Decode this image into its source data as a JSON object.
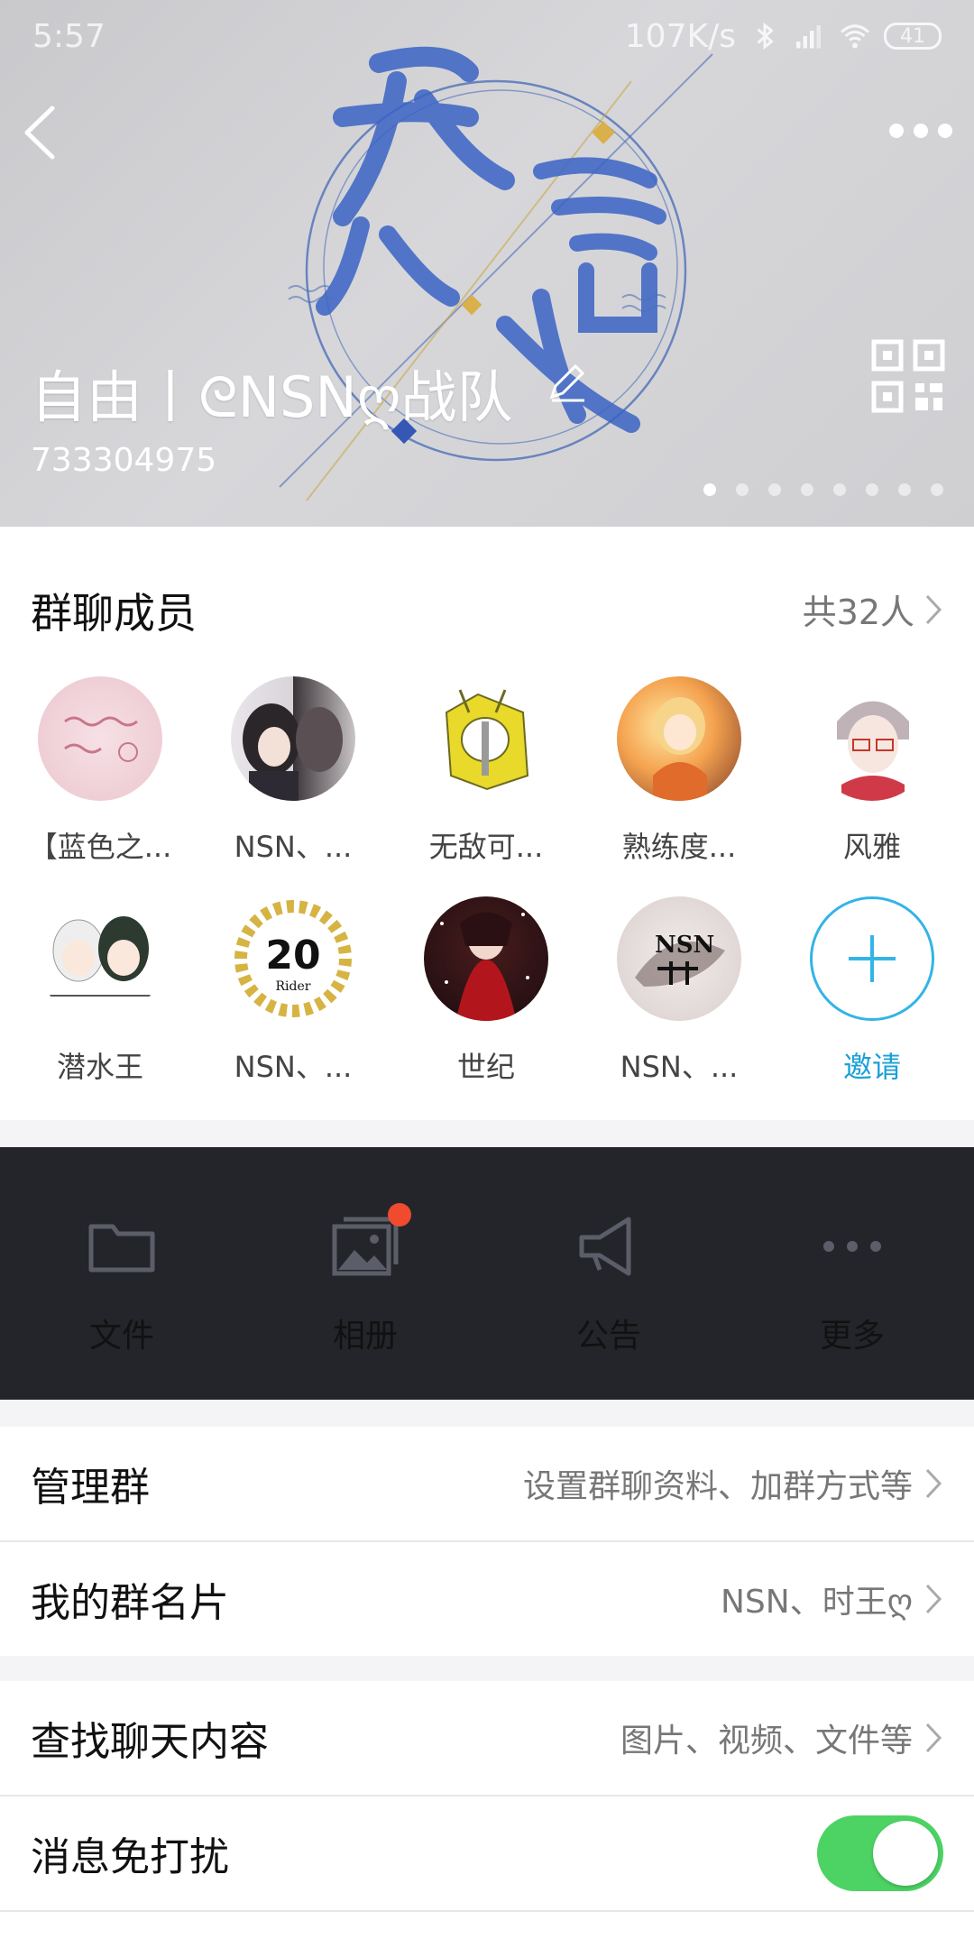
{
  "status_bar": {
    "time": "5:57",
    "speed": "107K/s",
    "battery": "41"
  },
  "header": {
    "group_name": "自由丨ᘓNSNღ战队",
    "group_id": "733304975",
    "banner_page_count": 8,
    "banner_active_page": 1
  },
  "members": {
    "title": "群聊成员",
    "count_label": "共32人",
    "items": [
      {
        "name": "【蓝色之...",
        "avatar": "pink-handwriting-avatar"
      },
      {
        "name": "NSN、...",
        "avatar": "anime-girl-mirror-avatar"
      },
      {
        "name": "无敌可...",
        "avatar": "yellow-hood-character-avatar"
      },
      {
        "name": "熟练度...",
        "avatar": "orange-anime-girl-avatar"
      },
      {
        "name": "风雅",
        "avatar": "glasses-boy-avatar"
      },
      {
        "name": "潜水王",
        "avatar": "two-anime-girls-avatar"
      },
      {
        "name": "NSN、...",
        "avatar": "kamen-rider-20-avatar"
      },
      {
        "name": "世纪",
        "avatar": "dark-red-anime-avatar"
      },
      {
        "name": "NSN、...",
        "avatar": "nsn-ink-logo-avatar"
      }
    ],
    "invite_label": "邀请"
  },
  "toolbar": {
    "items": [
      {
        "label": "文件",
        "icon": "folder-icon"
      },
      {
        "label": "相册",
        "icon": "album-icon"
      },
      {
        "label": "公告",
        "icon": "megaphone-icon"
      },
      {
        "label": "更多",
        "icon": "more-dots-icon"
      }
    ]
  },
  "settings": {
    "manage": {
      "title": "管理群",
      "value": "设置群聊资料、加群方式等"
    },
    "card": {
      "title": "我的群名片",
      "value": "NSN、时王ღ"
    },
    "search": {
      "title": "查找聊天内容",
      "value": "图片、视频、文件等"
    },
    "mute": {
      "title": "消息免打扰",
      "enabled": true
    }
  },
  "colors": {
    "accent_blue": "#1aa0d8",
    "toggle_green": "#4cd364",
    "badge_red": "#f04a2f",
    "toolbar_bg": "#23252a"
  }
}
